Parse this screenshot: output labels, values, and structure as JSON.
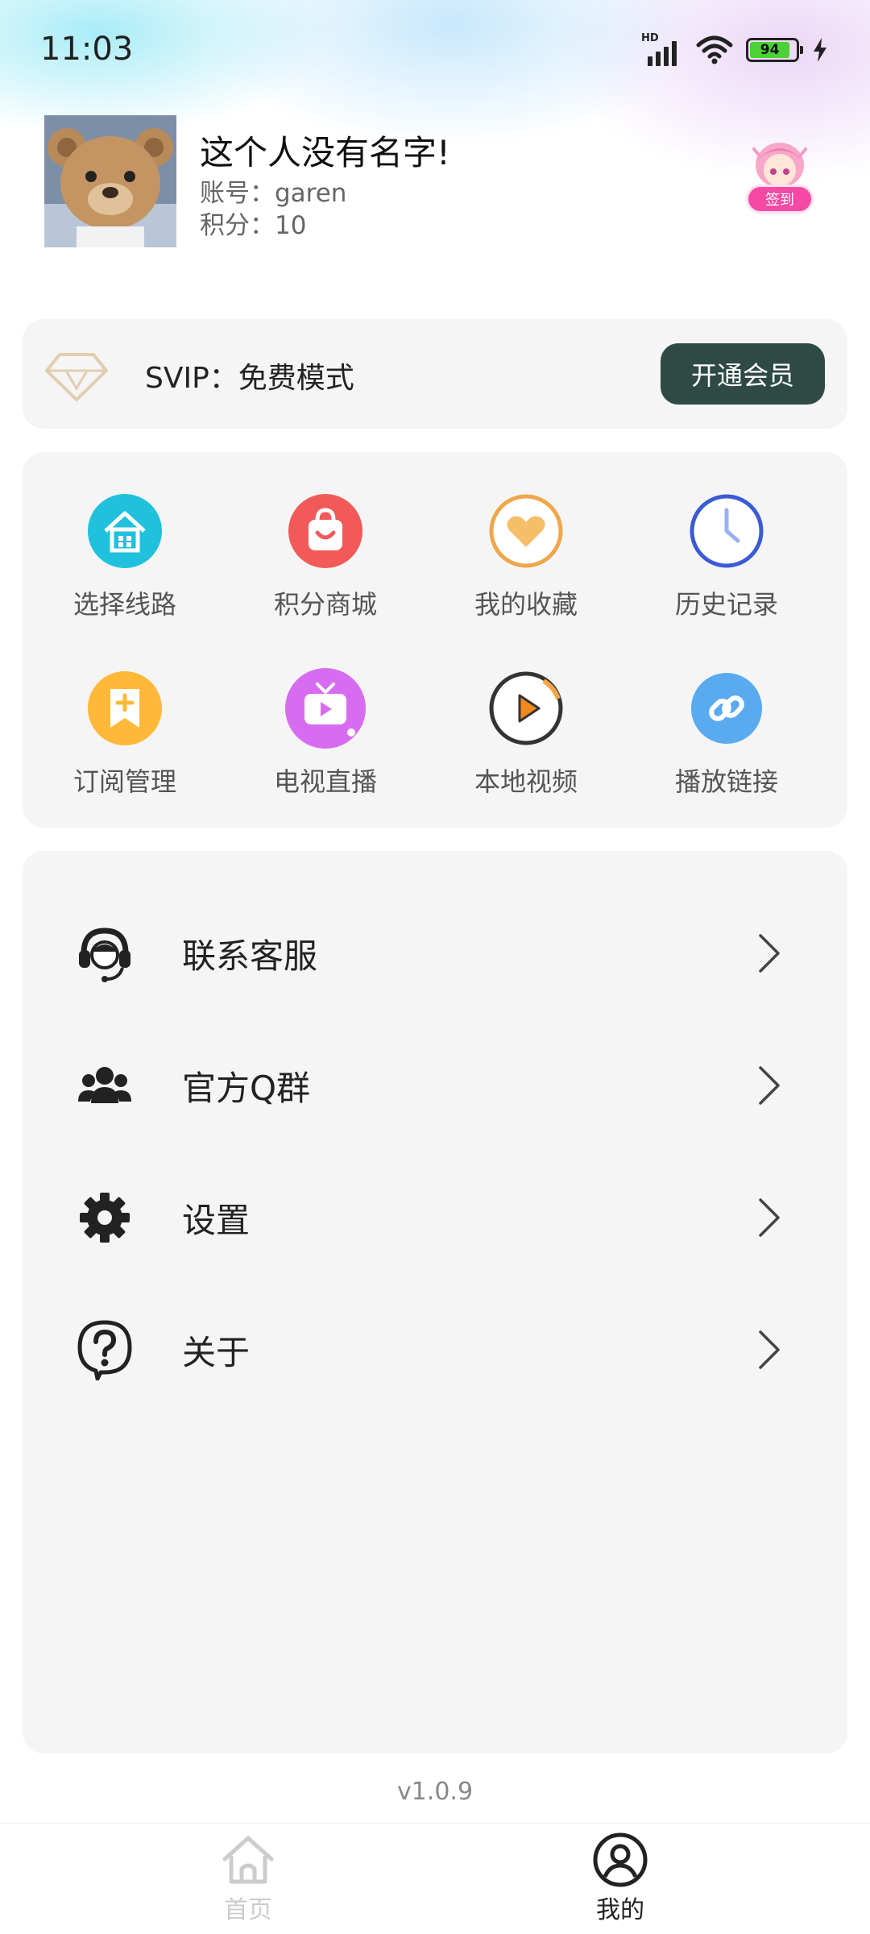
{
  "status_bar": {
    "time": "11:03",
    "network_badge": "HD",
    "battery_level": "94",
    "icons": [
      "signal-icon",
      "wifi-icon",
      "battery-icon",
      "charging-icon"
    ]
  },
  "profile": {
    "name": "这个人没有名字!",
    "account": "账号：garen",
    "points": "积分：10",
    "checkin_label": "签到"
  },
  "vip": {
    "text": "SVIP：免费模式",
    "button_label": "开通会员"
  },
  "features": [
    {
      "label": "选择线路",
      "icon": "route-house-icon",
      "color": "#1fc1dc"
    },
    {
      "label": "积分商城",
      "icon": "shopping-bag-icon",
      "color": "#f25a5a"
    },
    {
      "label": "我的收藏",
      "icon": "heart-icon",
      "color": "#f0a64a"
    },
    {
      "label": "历史记录",
      "icon": "clock-icon",
      "color": "#3b5bd6"
    },
    {
      "label": "订阅管理",
      "icon": "bookmark-plus-icon",
      "color": "#ffb83a"
    },
    {
      "label": "电视直播",
      "icon": "tv-icon",
      "color": "#d86cf0"
    },
    {
      "label": "本地视频",
      "icon": "play-circle-icon",
      "color": "#f08a1f"
    },
    {
      "label": "播放链接",
      "icon": "link-icon",
      "color": "#5aaaf0"
    }
  ],
  "menu": [
    {
      "label": "联系客服",
      "icon": "headset-icon"
    },
    {
      "label": "官方Q群",
      "icon": "group-icon"
    },
    {
      "label": "设置",
      "icon": "gear-icon"
    },
    {
      "label": "关于",
      "icon": "question-icon"
    }
  ],
  "version": "v1.0.9",
  "nav": [
    {
      "label": "首页",
      "icon": "home-icon",
      "active": false
    },
    {
      "label": "我的",
      "icon": "user-circle-icon",
      "active": true
    }
  ],
  "colors": {
    "accent_dark": "#2f4a44",
    "card_bg": "#f5f5f5",
    "checkin_pink": "#f44aa4",
    "nav_active": "#222222",
    "nav_inactive": "#cccccc"
  }
}
